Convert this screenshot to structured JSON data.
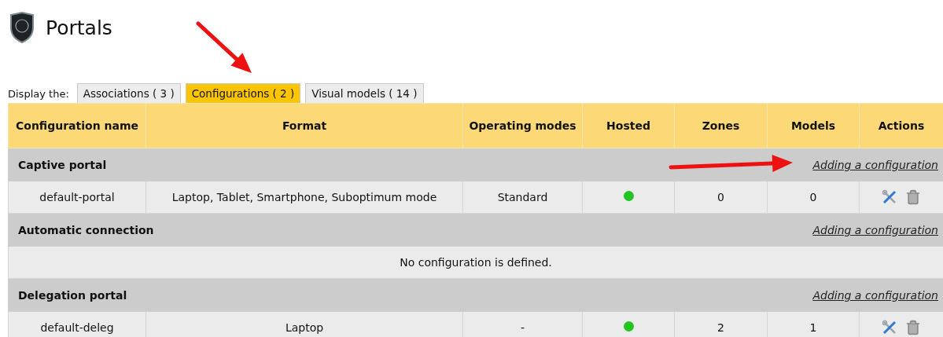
{
  "page": {
    "title": "Portals"
  },
  "display_label": "Display the:",
  "tabs": [
    {
      "label": "Associations ( 3 )",
      "selected": false
    },
    {
      "label": "Configurations ( 2 )",
      "selected": true
    },
    {
      "label": "Visual models ( 14 )",
      "selected": false
    }
  ],
  "table": {
    "columns": [
      "Configuration name",
      "Format",
      "Operating modes",
      "Hosted",
      "Zones",
      "Models",
      "Actions"
    ],
    "sections": [
      {
        "title": "Captive portal",
        "link": "Adding a configuration",
        "rows": [
          {
            "name": "default-portal",
            "format": "Laptop, Tablet, Smartphone, Suboptimum mode",
            "modes": "Standard",
            "hosted": true,
            "zones": "0",
            "models": "0"
          }
        ]
      },
      {
        "title": "Automatic connection",
        "link": "Adding a configuration",
        "empty_message": "No configuration is defined."
      },
      {
        "title": "Delegation portal",
        "link": "Adding a configuration",
        "rows": [
          {
            "name": "default-deleg",
            "format": "Laptop",
            "modes": "-",
            "hosted": true,
            "zones": "2",
            "models": "1"
          }
        ]
      }
    ]
  }
}
